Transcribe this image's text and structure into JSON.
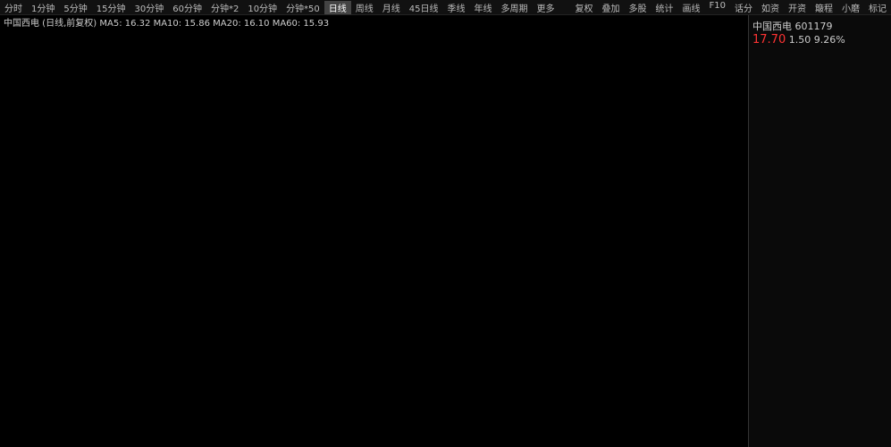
{
  "periods": [
    "分时",
    "1分钟",
    "5分钟",
    "15分钟",
    "30分钟",
    "60分钟",
    "分钟*2",
    "10分钟",
    "分钟*50",
    "日线",
    "周线",
    "月线",
    "45日线",
    "季线",
    "年线",
    "多周期",
    "更多"
  ],
  "toolbar": [
    "复权",
    "叠加",
    "多股",
    "统计",
    "画线",
    "F10",
    "话分",
    "如资",
    "开资",
    "簸程",
    "小磨",
    "标记"
  ],
  "chart_info": {
    "name": "中国西电 (日线,前复权)",
    "ma5": "MA5: 16.32",
    "ma10": "MA10: 15.86",
    "ma20": "MA20: 16.10",
    "ma60": "MA60: 15.93"
  },
  "sidebar": {
    "title": "中国西电 601179",
    "price": "17.70",
    "change": "1.50",
    "change_pct": "9.26%"
  }
}
